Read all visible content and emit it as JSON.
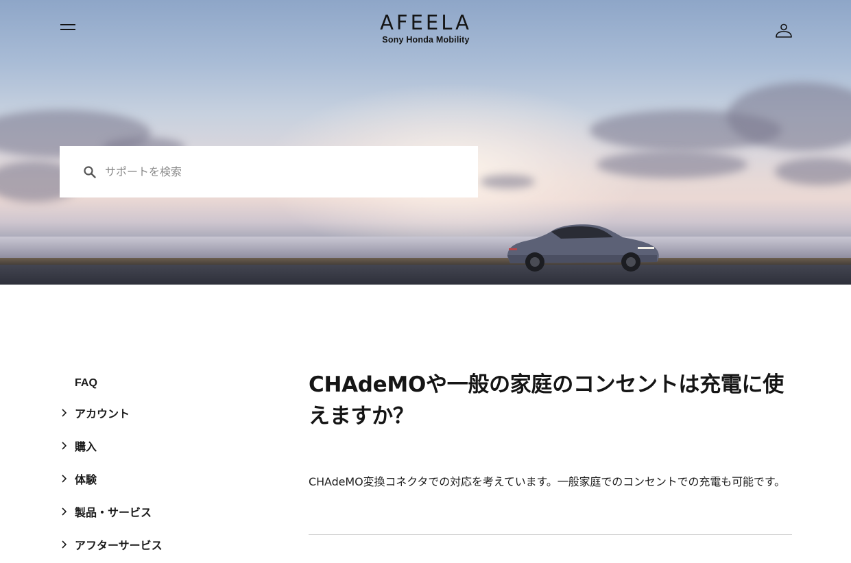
{
  "header": {
    "brand": "AFEELA",
    "brand_sub": "Sony Honda Mobility"
  },
  "search": {
    "placeholder": "サポートを検索"
  },
  "sidebar": {
    "heading": "FAQ",
    "items": [
      {
        "label": "アカウント"
      },
      {
        "label": "購入"
      },
      {
        "label": "体験"
      },
      {
        "label": "製品・サービス"
      },
      {
        "label": "アフターサービス"
      }
    ]
  },
  "article": {
    "title": "CHAdeMOや一般の家庭のコンセントは充電に使えますか？",
    "body": "CHAdeMO変換コネクタでの対応を考えています。一般家庭でのコンセントでの充電も可能です。"
  },
  "icons": {
    "menu": "hamburger-menu-icon",
    "account": "user-icon",
    "search": "search-icon",
    "chevron": "chevron-right-icon"
  }
}
